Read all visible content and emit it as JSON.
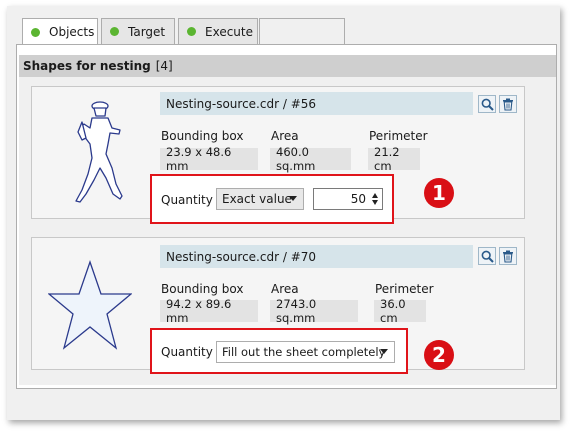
{
  "tabs": [
    {
      "label": "Objects",
      "status_color": "#5bb531",
      "active": true
    },
    {
      "label": "Target",
      "status_color": "#5bb531",
      "active": false
    },
    {
      "label": "Execute",
      "status_color": "#5bb531",
      "active": false
    }
  ],
  "panel": {
    "title": "Shapes for nesting",
    "count": "[4]"
  },
  "shapes": [
    {
      "file": "Nesting-source.cdr / #56",
      "bbox_label": "Bounding box",
      "bbox_value": "23.9 x 48.6 mm",
      "area_label": "Area",
      "area_value": "460.0 sq.mm",
      "perimeter_label": "Perimeter",
      "perimeter_value": "21.2 cm",
      "quantity_label": "Quantity",
      "quantity_mode": "Exact value",
      "quantity_value": "50",
      "badge": "1",
      "thumbnail": "hiker-silhouette"
    },
    {
      "file": "Nesting-source.cdr / #70",
      "bbox_label": "Bounding box",
      "bbox_value": "94.2 x 89.6 mm",
      "area_label": "Area",
      "area_value": "2743.0 sq.mm",
      "perimeter_label": "Perimeter",
      "perimeter_value": "36.0 cm",
      "quantity_label": "Quantity",
      "quantity_mode": "Fill out the sheet completely",
      "badge": "2",
      "thumbnail": "star-shape"
    }
  ],
  "colors": {
    "highlight": "#e0141a",
    "badge": "#d90f15",
    "filename_bg": "#d6e4ea",
    "status_dot": "#5bb531"
  }
}
